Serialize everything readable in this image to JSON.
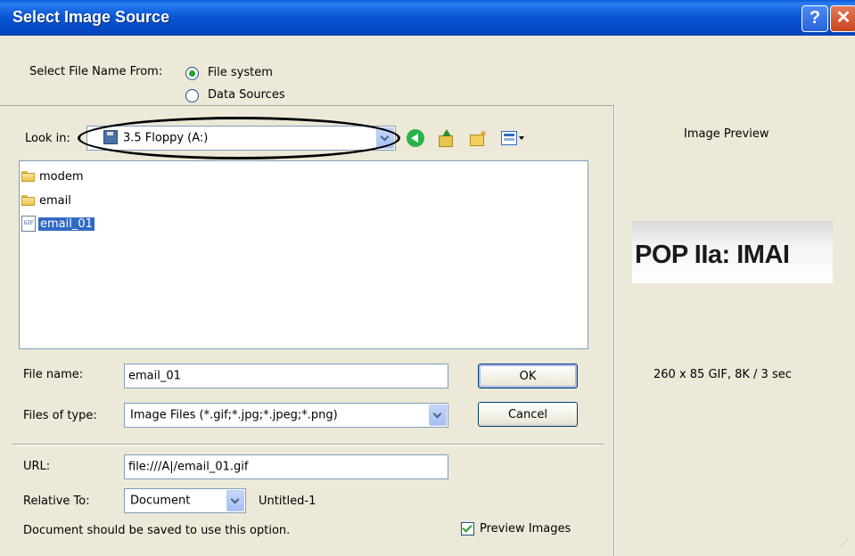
{
  "window": {
    "title": "Select Image Source",
    "help_label": "?",
    "close_label": "✕"
  },
  "source": {
    "label": "Select File Name From:",
    "options": [
      {
        "label": "File system",
        "selected": true
      },
      {
        "label": "Data Sources",
        "selected": false
      }
    ]
  },
  "lookin": {
    "label": "Look in:",
    "value": "3.5 Floppy (A:)",
    "icons": [
      "back-icon",
      "up-folder-icon",
      "new-folder-icon",
      "views-menu-icon"
    ]
  },
  "files": [
    {
      "name": "modem",
      "type": "folder",
      "selected": false
    },
    {
      "name": "email",
      "type": "folder",
      "selected": false
    },
    {
      "name": "email_01",
      "type": "gif",
      "icon_text": "GIF",
      "selected": true
    }
  ],
  "filename": {
    "label": "File name:",
    "value": "email_01"
  },
  "filetype": {
    "label": "Files of type:",
    "value": "Image Files (*.gif;*.jpg;*.jpeg;*.png)"
  },
  "buttons": {
    "ok": "OK",
    "cancel": "Cancel"
  },
  "url": {
    "label": "URL:",
    "value": "file:///A|/email_01.gif"
  },
  "relative": {
    "label": "Relative To:",
    "value": "Document",
    "doc_name": "Untitled-1"
  },
  "note": "Document should be saved to use this option.",
  "preview_images": {
    "label": "Preview Images",
    "checked": true
  },
  "preview": {
    "heading": "Image Preview",
    "image_text": "POP IIa: IMAI",
    "info": "260 x 85 GIF, 8K / 3 sec"
  },
  "colors": {
    "title_bar": "#0a58d6",
    "selection": "#316ac5",
    "dialog_bg": "#ece9d8",
    "annotation_oval": "#000000"
  }
}
